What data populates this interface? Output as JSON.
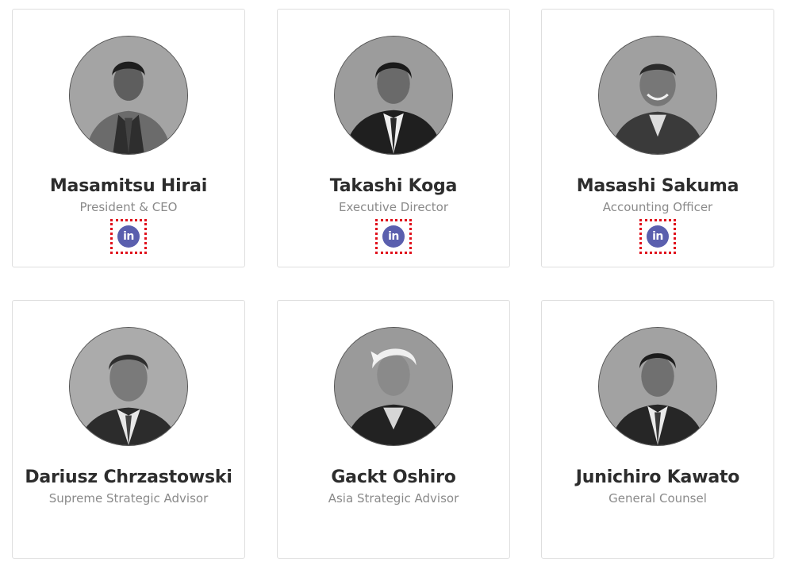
{
  "colors": {
    "name_text": "#2d2d2d",
    "role_text": "#8a8a8a",
    "card_border": "#dedede",
    "linkedin_badge": "#5a5fae",
    "focus_outline": "#e0101b"
  },
  "team": [
    {
      "name": "Masamitsu Hirai",
      "role": "President & CEO",
      "photo_icon": "portrait-photo",
      "social": {
        "icon": "linkedin-icon",
        "text": "in"
      }
    },
    {
      "name": "Takashi Koga",
      "role": "Executive Director",
      "photo_icon": "portrait-photo",
      "social": {
        "icon": "linkedin-icon",
        "text": "in"
      }
    },
    {
      "name": "Masashi Sakuma",
      "role": "Accounting Officer",
      "photo_icon": "portrait-photo",
      "social": {
        "icon": "linkedin-icon",
        "text": "in"
      }
    },
    {
      "name": "Dariusz Chrzastowski",
      "role": "Supreme Strategic Advisor",
      "photo_icon": "portrait-photo"
    },
    {
      "name": "Gackt Oshiro",
      "role": "Asia Strategic Advisor",
      "photo_icon": "portrait-photo"
    },
    {
      "name": "Junichiro Kawato",
      "role": "General Counsel",
      "photo_icon": "portrait-photo"
    }
  ]
}
